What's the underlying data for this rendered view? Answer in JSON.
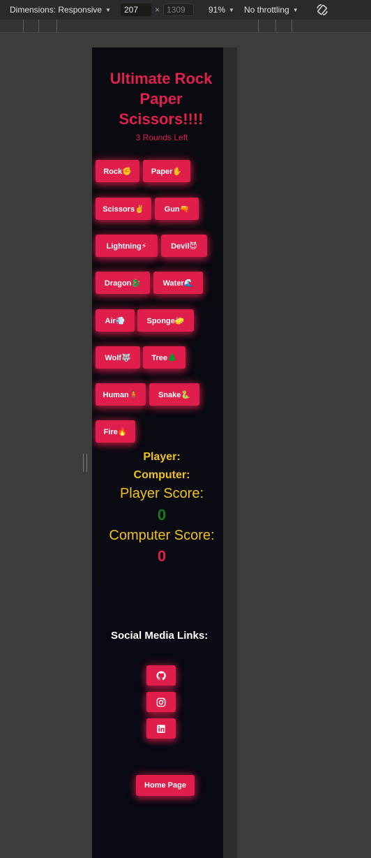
{
  "devtools": {
    "dimensions_label": "Dimensions: Responsive",
    "width_value": "207",
    "times": "×",
    "height_value": "1309",
    "zoom": "91%",
    "throttling": "No throttling"
  },
  "game": {
    "title_lines": [
      "Ultimate Rock",
      "Paper",
      "Scissors!!!!"
    ],
    "rounds_left": "3 Rounds Left",
    "choices": [
      "Rock✊",
      "Paper✋",
      "Scissors✌️",
      "Gun🔫",
      "Lightning⚡",
      "Devil😈",
      "Dragon🐉",
      "Water🌊",
      "Air💨",
      "Sponge🧽",
      "Wolf🐺",
      "Tree🌲",
      "Human🧍",
      "Snake🐍",
      "Fire🔥"
    ],
    "player_label": "Player:",
    "computer_label": "Computer:",
    "player_score_label": "Player Score:",
    "player_score": "0",
    "computer_score_label": "Computer Score:",
    "computer_score": "0"
  },
  "social": {
    "title": "Social Media Links:",
    "links": [
      "github-icon",
      "instagram-icon",
      "linkedin-icon"
    ]
  },
  "home_button": "Home Page",
  "colors": {
    "accent": "#e01e4c",
    "score_label": "#f2c21b",
    "player_score": "#1a7a1a",
    "computer_score": "#e0204d",
    "page_background": "#090b12"
  }
}
